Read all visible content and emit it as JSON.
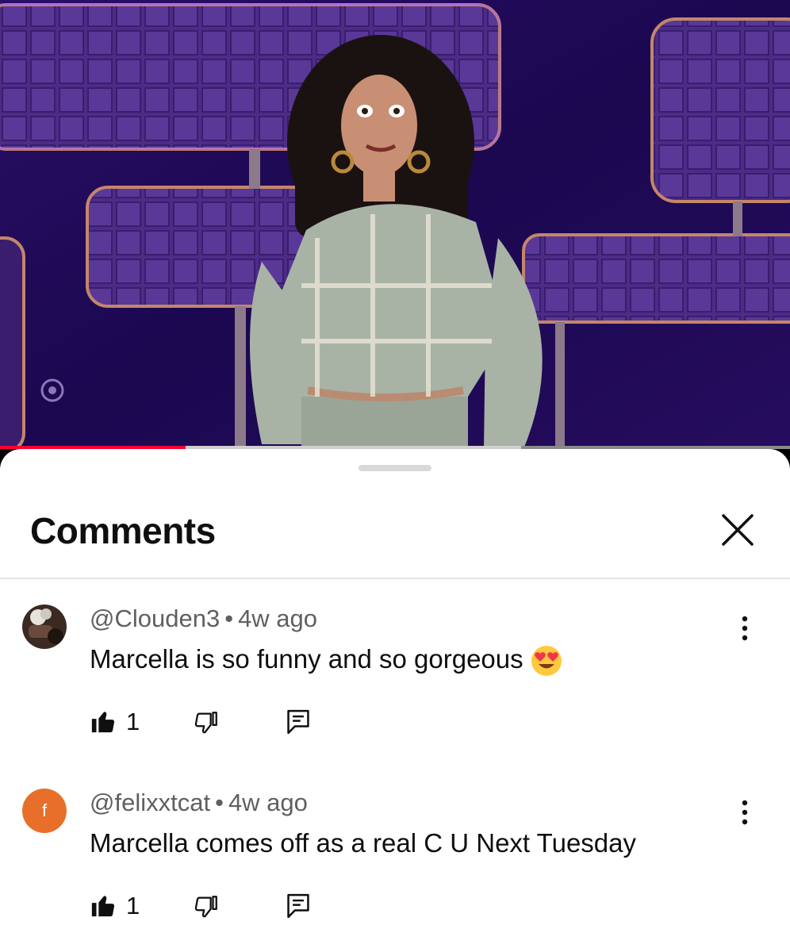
{
  "video": {
    "progress_fraction": 0.235,
    "buffered_fraction": 0.66,
    "colors": {
      "progress": "#ff0033",
      "buffer": "#cfcfcf",
      "track": "#8a8a8a"
    }
  },
  "sheet": {
    "title": "Comments",
    "icons": [
      "close-icon",
      "more-vert-icon",
      "thumbs-up-icon",
      "thumbs-down-icon",
      "reply-icon"
    ]
  },
  "comments": [
    {
      "author": "@Clouden3",
      "separator": "•",
      "time": "4w ago",
      "text": "Marcella is so funny and so gorgeous",
      "emoji": "heart-eyes-emoji",
      "likes": "1",
      "avatar": {
        "type": "image"
      }
    },
    {
      "author": "@felixxtcat",
      "separator": "•",
      "time": "4w ago",
      "text": "Marcella comes off as a real C U Next Tuesday",
      "likes": "1",
      "avatar": {
        "type": "letter",
        "letter": "f",
        "color": "#e86f2a"
      }
    }
  ]
}
